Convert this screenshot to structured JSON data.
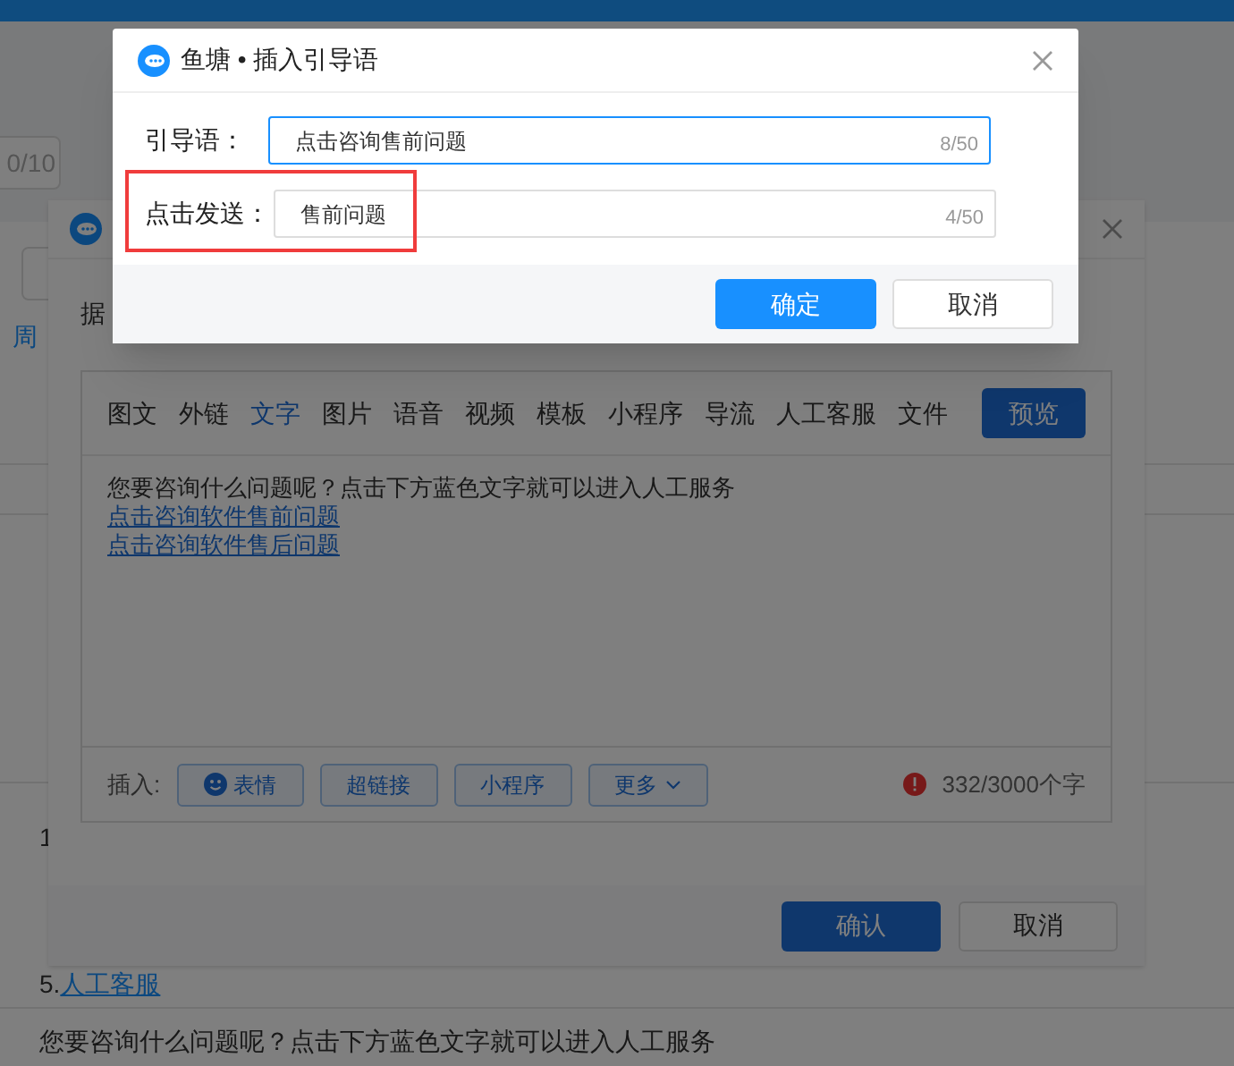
{
  "background_page": {
    "counter": "0/10",
    "link_fragment": "周",
    "numbered_items": [
      "1"
    ],
    "last_item": {
      "number": "5.",
      "link": "人工客服"
    },
    "footer_text": "您要咨询什么问题呢？点击下方蓝色文字就可以进入人工服务"
  },
  "editor_dialog": {
    "row_label": "据",
    "tabs": [
      {
        "label": "图文",
        "selected": false
      },
      {
        "label": "外链",
        "selected": false
      },
      {
        "label": "文字",
        "selected": true
      },
      {
        "label": "图片",
        "selected": false
      },
      {
        "label": "语音",
        "selected": false
      },
      {
        "label": "视频",
        "selected": false
      },
      {
        "label": "模板",
        "selected": false
      },
      {
        "label": "小程序",
        "selected": false
      },
      {
        "label": "导流",
        "selected": false
      },
      {
        "label": "人工客服",
        "selected": false
      },
      {
        "label": "文件",
        "selected": false
      }
    ],
    "preview_button": "预览",
    "content": {
      "text": "您要咨询什么问题呢？点击下方蓝色文字就可以进入人工服务",
      "links": [
        "点击咨询软件售前问题",
        "点击咨询软件售后问题"
      ]
    },
    "insert_label": "插入:",
    "insert_buttons": [
      {
        "label": "表情",
        "kind": "emoji"
      },
      {
        "label": "超链接",
        "kind": "plain"
      },
      {
        "label": "小程序",
        "kind": "plain"
      },
      {
        "label": "更多",
        "kind": "dropdown"
      }
    ],
    "char_count": "332/3000个字",
    "confirm_button": "确认",
    "cancel_button": "取消"
  },
  "insert_dialog": {
    "title": "鱼塘 • 插入引导语",
    "fields": [
      {
        "label": "引导语：",
        "value": "点击咨询售前问题",
        "count": "8/50",
        "focused": true
      },
      {
        "label": "点击发送：",
        "value": "售前问题",
        "count": "4/50",
        "focused": false,
        "highlighted": true
      }
    ],
    "ok_button": "确定",
    "cancel_button": "取消"
  }
}
